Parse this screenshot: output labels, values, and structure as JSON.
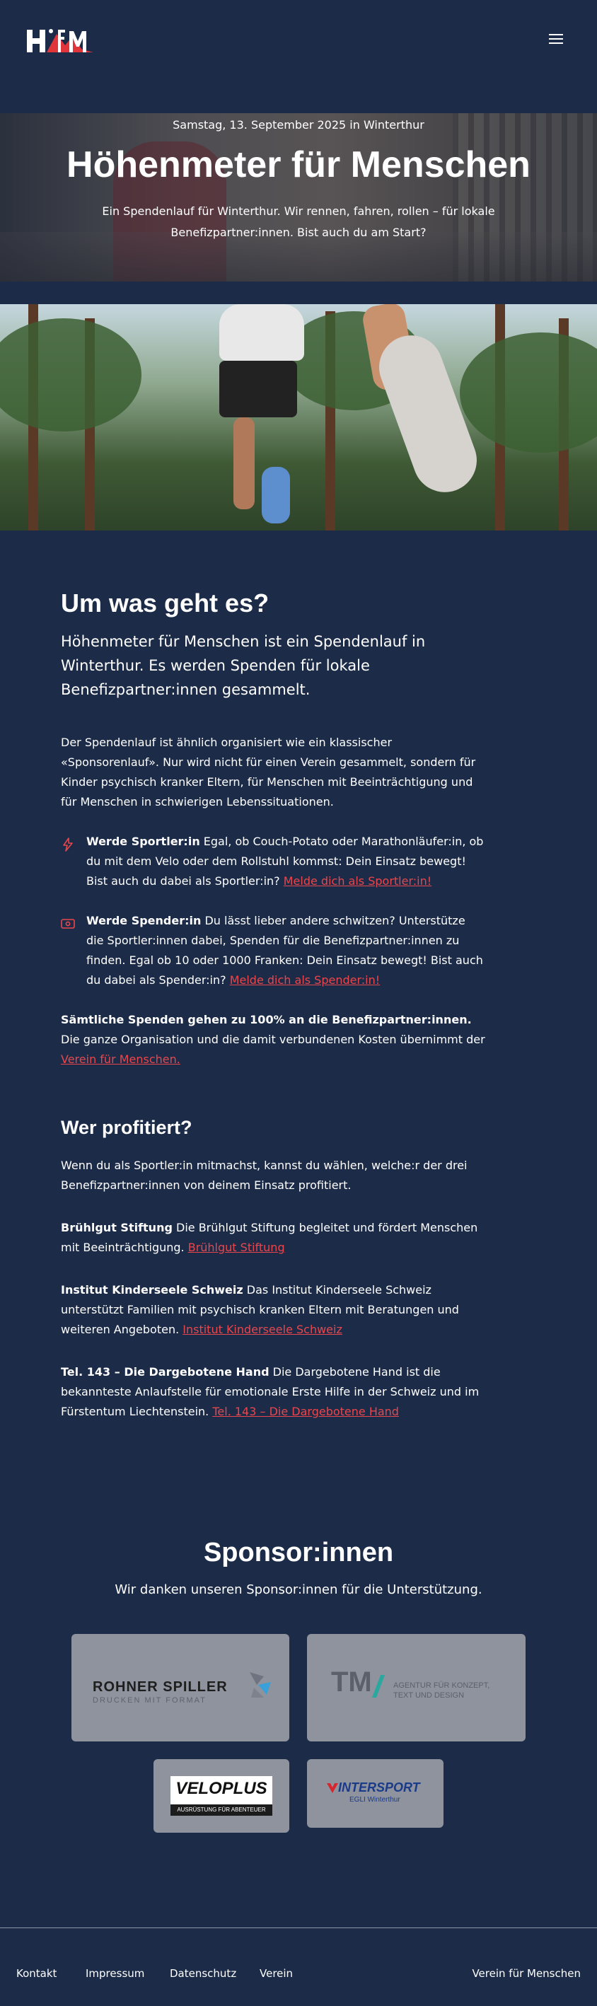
{
  "header": {
    "logo_text": "HFM",
    "menu_icon": "hamburger-menu-icon"
  },
  "hero": {
    "date": "Samstag, 13. September 2025 in Winterthur",
    "title": "Höhenmeter für Menschen",
    "subtitle": "Ein Spendenlauf für Winterthur. Wir rennen, fahren, rollen – für lokale Benefizpartner:innen. Bist auch du am Start?"
  },
  "about": {
    "heading": "Um was geht es?",
    "lead": "Höhenmeter für Menschen ist ein Spendenlauf in Winterthur. Es werden Spenden für lokale Benefizpartner:innen gesammelt.",
    "intro": "Der Spendenlauf ist ähnlich organisiert wie ein klassischer «Sponsorenlauf». Nur wird nicht für einen Verein gesammelt, sondern für Kinder psychisch kranker Eltern, für Menschen mit Beeinträchtigung und für Menschen in schwierigen Lebenssituationen.",
    "features": [
      {
        "icon": "lightning-icon",
        "title": "Werde Sportler:in",
        "text": " Egal, ob Couch-Potato oder Marathonläufer:in, ob du mit dem Velo oder dem Rollstuhl kommst: Dein Einsatz bewegt! Bist auch du dabei als Sportler:in? ",
        "link": "Melde dich als Sportler:in!"
      },
      {
        "icon": "money-icon",
        "title": "Werde Spender:in",
        "text": " Du lässt lieber andere schwitzen? Unterstütze die Sportler:innen dabei, Spenden für die Benefizpartner:innen zu finden. Egal ob 10 oder 1000 Franken: Dein Einsatz bewegt! Bist auch du dabei als Spender:in? ",
        "link": "Melde dich als Spender:in!"
      }
    ],
    "note_bold": "Sämtliche Spenden gehen zu 100% an die Benefizpartner:innen.",
    "note_text": " Die ganze Organisation und die damit verbundenen Kosten übernimmt der ",
    "note_link": "Verein für Menschen."
  },
  "beneficiaries": {
    "heading": "Wer profitiert?",
    "intro": "Wenn du als Sportler:in mitmachst, kannst du wählen, welche:r der drei Benefizpartner:innen von deinem Einsatz profitiert.",
    "items": [
      {
        "name": "Brühlgut Stiftung",
        "text": " Die Brühlgut Stiftung begleitet und fördert Menschen mit Beeinträchtigung. ",
        "link": "Brühlgut Stiftung"
      },
      {
        "name": "Institut Kinderseele Schweiz",
        "text": " Das Institut Kinderseele Schweiz unterstützt Familien mit psychisch kranken Eltern mit Beratungen und weiteren Angeboten. ",
        "link": "Institut Kinderseele Schweiz"
      },
      {
        "name": "Tel. 143 – Die Dargebotene Hand",
        "text": " Die Dargebotene Hand ist die bekannteste Anlaufstelle für emotionale Erste Hilfe in der Schweiz und im Fürstentum Liechtenstein. ",
        "link": "Tel. 143 – Die Dargebotene Hand"
      }
    ]
  },
  "sponsors": {
    "heading": "Sponsor:innen",
    "subtitle": "Wir danken unseren Sponsor:innen für die Unterstützung.",
    "logos": [
      {
        "name": "ROHNER SPILLER",
        "tagline": "DRUCKEN MIT FORMAT"
      },
      {
        "name": "TM",
        "tagline": "AGENTUR FÜR KONZEPT, TEXT UND DESIGN"
      },
      {
        "name": "VELOPLUS",
        "tagline": "AUSRÜSTUNG FÜR ABENTEUER"
      },
      {
        "name": "INTERSPORT",
        "tagline": "EGLI Winterthur"
      }
    ]
  },
  "footer": {
    "links": [
      "Kontakt",
      "Impressum",
      "Datenschutz",
      "Verein"
    ],
    "right": "Verein für Menschen"
  },
  "colors": {
    "background": "#1c2b47",
    "accent": "#e8474d",
    "card": "#8e939d"
  }
}
